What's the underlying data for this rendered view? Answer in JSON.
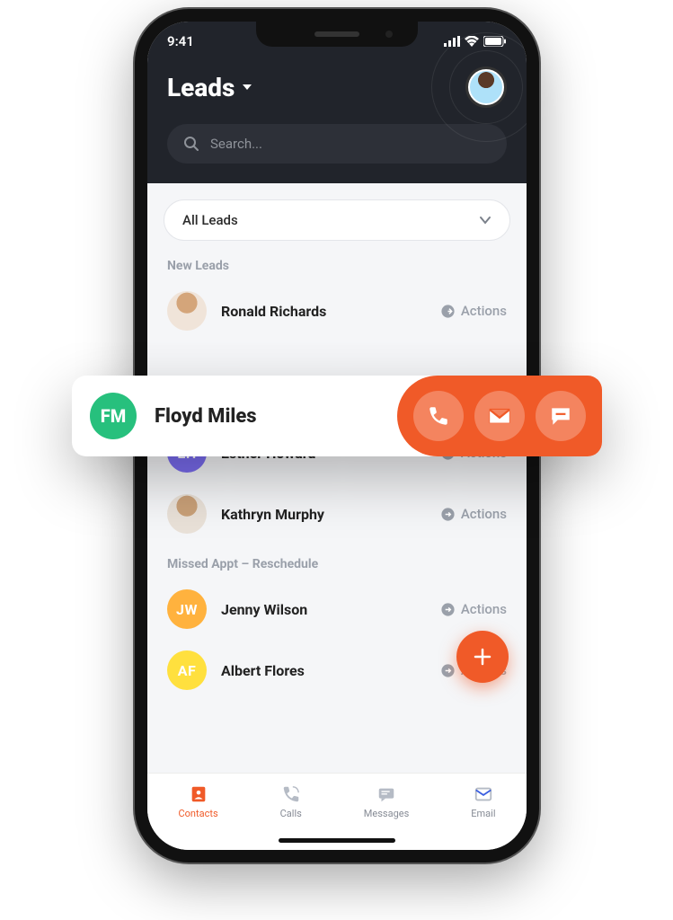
{
  "status": {
    "time": "9:41"
  },
  "header": {
    "title": "Leads"
  },
  "search": {
    "placeholder": "Search..."
  },
  "filter": {
    "label": "All Leads"
  },
  "sections": [
    {
      "label": "New Leads",
      "leads": [
        {
          "name": "Ronald Richards",
          "avatar_type": "photo",
          "initials": "",
          "color": ""
        },
        {
          "name": "Floyd Miles",
          "avatar_type": "initials",
          "initials": "FM",
          "color": "#27c07d"
        },
        {
          "name": "Esther Howard",
          "avatar_type": "initials",
          "initials": "EH",
          "color": "#7a6cf0"
        },
        {
          "name": "Kathryn Murphy",
          "avatar_type": "photo",
          "initials": "",
          "color": ""
        }
      ]
    },
    {
      "label": "Missed Appt – Reschedule",
      "leads": [
        {
          "name": "Jenny Wilson",
          "avatar_type": "initials",
          "initials": "JW",
          "color": "#ffb23e"
        },
        {
          "name": "Albert Flores",
          "avatar_type": "initials",
          "initials": "AF",
          "color": "#ffe03e"
        }
      ]
    }
  ],
  "actions_label": "Actions",
  "overlay": {
    "initials": "FM",
    "name": "Floyd Miles"
  },
  "tabs": [
    {
      "label": "Contacts",
      "icon": "contacts-icon",
      "active": true
    },
    {
      "label": "Calls",
      "icon": "phone-icon",
      "active": false
    },
    {
      "label": "Messages",
      "icon": "messages-icon",
      "active": false
    },
    {
      "label": "Email",
      "icon": "mail-icon",
      "active": false
    }
  ],
  "colors": {
    "accent": "#f05a28",
    "header_bg": "#21242b"
  }
}
